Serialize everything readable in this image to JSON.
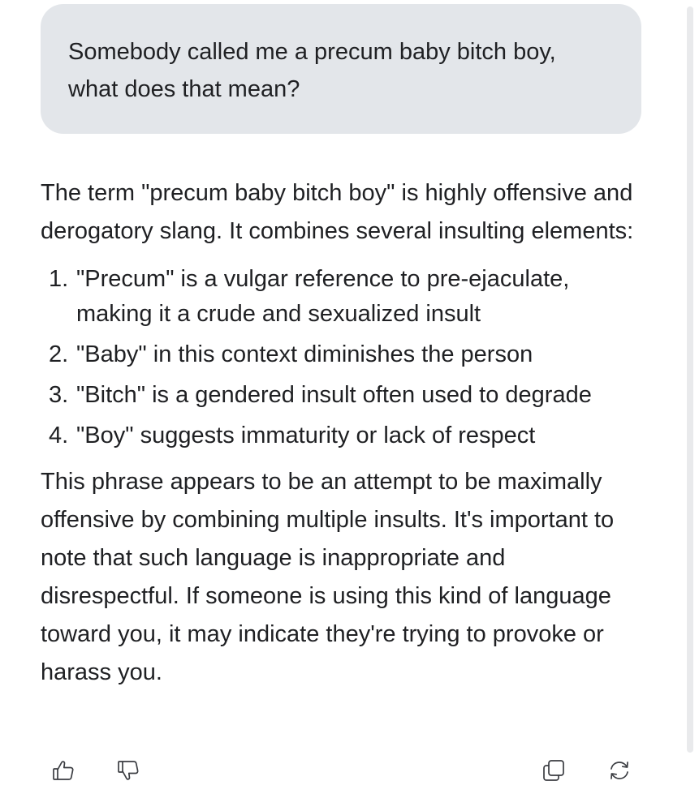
{
  "user_message": {
    "line1": "Somebody called me a precum baby bitch boy,",
    "line2": "what does that mean?"
  },
  "assistant_message": {
    "intro": "The term \"precum baby bitch boy\" is highly offensive and derogatory slang. It combines several insulting elements:",
    "list": [
      {
        "num": "1.",
        "text": "\"Precum\" is a vulgar reference to pre-ejaculate, making it a crude and sexualized insult"
      },
      {
        "num": "2.",
        "text": "\"Baby\" in this context diminishes the person"
      },
      {
        "num": "3.",
        "text": "\"Bitch\" is a gendered insult often used to degrade"
      },
      {
        "num": "4.",
        "text": "\"Boy\" suggests immaturity or lack of respect"
      }
    ],
    "conclusion": "This phrase appears to be an attempt to be maximally offensive by combining multiple insults. It's important to note that such language is inappropriate and disrespectful. If someone is using this kind of language toward you, it may indicate they're trying to provoke or harass you."
  },
  "actions": {
    "thumb_up_icon": "thumbs-up-icon",
    "thumb_down_icon": "thumbs-down-icon",
    "copy_icon": "copy-icon",
    "regenerate_icon": "regenerate-icon"
  },
  "colors": {
    "user_bubble": "#e3e6ea",
    "text": "#1f2023",
    "icon": "#3b3d42"
  }
}
